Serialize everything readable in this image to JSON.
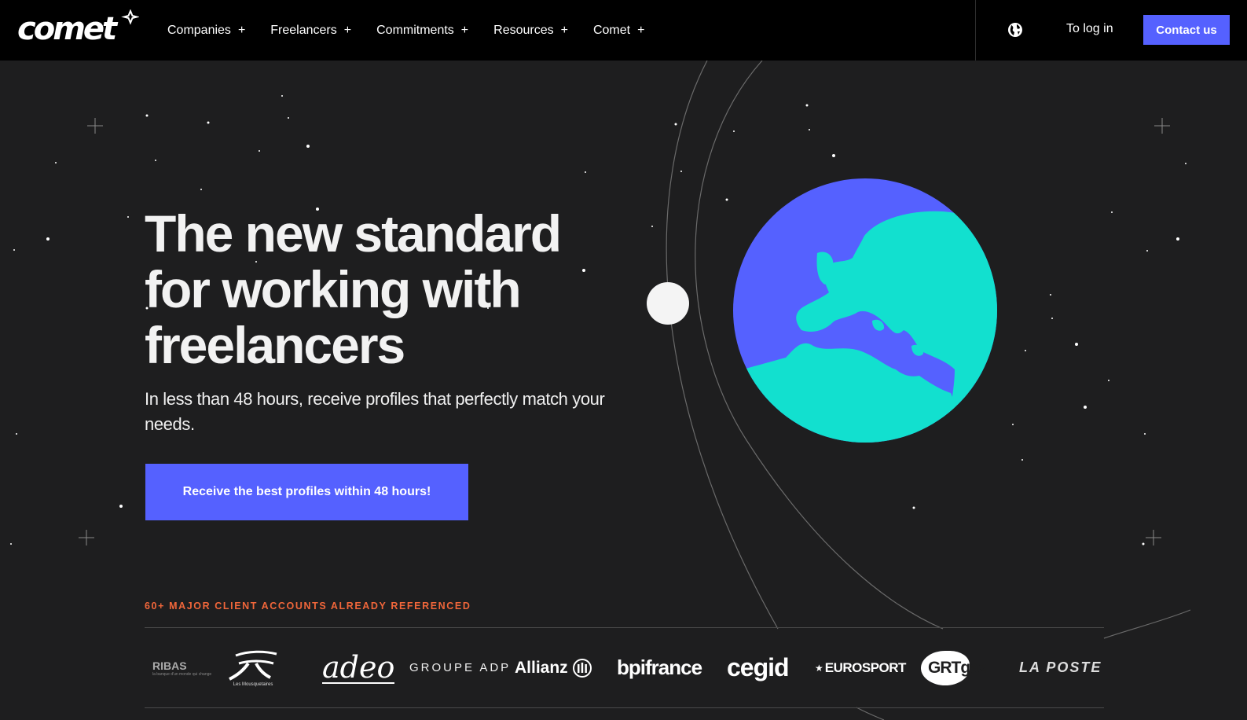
{
  "brand": {
    "name": "comet"
  },
  "nav": {
    "items": [
      {
        "label": "Companies",
        "suffix": "+"
      },
      {
        "label": "Freelancers",
        "suffix": "+"
      },
      {
        "label": "Commitments",
        "suffix": "+"
      },
      {
        "label": "Resources",
        "suffix": "+"
      },
      {
        "label": "Comet",
        "suffix": "+"
      }
    ],
    "language_icon": "globe-icon",
    "login_label": "To log in",
    "contact_label": "Contact us"
  },
  "hero": {
    "headline_lines": [
      "The new standard",
      "for working with",
      "freelancers"
    ],
    "subtitle": "In less than 48 hours, receive profiles that perfectly match your needs.",
    "cta_label": "Receive the best profiles within 48 hours!"
  },
  "clients": {
    "title": "60+ MAJOR CLIENT ACCOUNTS ALREADY REFERENCED",
    "logos": [
      {
        "text": "RIBAS",
        "subtext": "la banque d'un monde qui change"
      },
      {
        "text": "",
        "subtext": "Les Mousquetaires"
      },
      {
        "text": "adeo",
        "subtext": ""
      },
      {
        "text": "GROUPE ADP",
        "subtext": ""
      },
      {
        "text": "Allianz",
        "subtext": ""
      },
      {
        "text": "bpifrance",
        "subtext": ""
      },
      {
        "text": "cegid",
        "subtext": ""
      },
      {
        "text": "EUROSPORT",
        "subtext": ""
      },
      {
        "text": "GRTgaz",
        "subtext": ""
      },
      {
        "text": "LA POSTE",
        "subtext": ""
      }
    ]
  },
  "colors": {
    "accent": "#5561ff",
    "background": "#1e1e1f",
    "nav_background": "#000000",
    "planet_ocean": "#5561ff",
    "planet_land": "#12e0cf",
    "highlight_text": "#f0663a"
  }
}
